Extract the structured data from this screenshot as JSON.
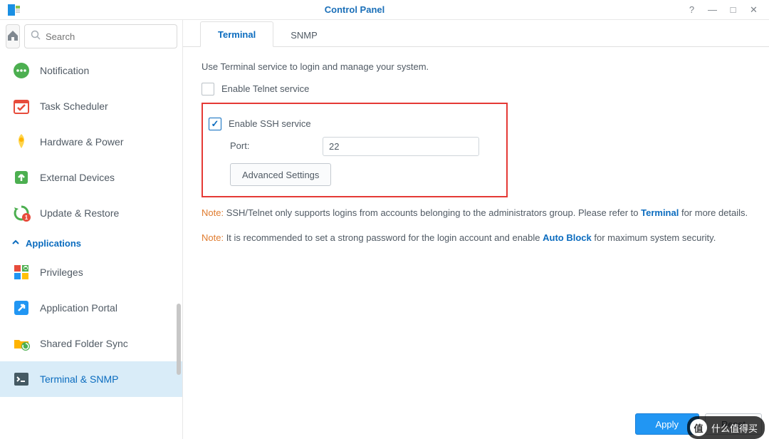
{
  "window": {
    "title": "Control Panel"
  },
  "search": {
    "placeholder": "Search"
  },
  "sidebar": {
    "items": [
      {
        "label": "Notification"
      },
      {
        "label": "Task Scheduler"
      },
      {
        "label": "Hardware & Power"
      },
      {
        "label": "External Devices"
      },
      {
        "label": "Update & Restore"
      }
    ],
    "section": "Applications",
    "apps": [
      {
        "label": "Privileges"
      },
      {
        "label": "Application Portal"
      },
      {
        "label": "Shared Folder Sync"
      },
      {
        "label": "Terminal & SNMP"
      }
    ]
  },
  "tabs": [
    {
      "label": "Terminal",
      "active": true
    },
    {
      "label": "SNMP",
      "active": false
    }
  ],
  "terminal": {
    "desc": "Use Terminal service to login and manage your system.",
    "telnet_label": "Enable Telnet service",
    "ssh_label": "Enable SSH service",
    "ssh_checked": true,
    "port_label": "Port:",
    "port_value": "22",
    "adv_btn": "Advanced Settings",
    "note1_prefix": "Note:",
    "note1_body": " SSH/Telnet only supports logins from accounts belonging to the administrators group. Please refer to ",
    "note1_link": "Terminal",
    "note1_tail": " for more details.",
    "note2_prefix": "Note:",
    "note2_body": " It is recommended to set a strong password for the login account and enable ",
    "note2_link": "Auto Block",
    "note2_tail": " for maximum system security."
  },
  "footer": {
    "apply": "Apply",
    "reset": "Reset"
  },
  "watermark": {
    "badge": "值",
    "text": "什么值得买"
  }
}
